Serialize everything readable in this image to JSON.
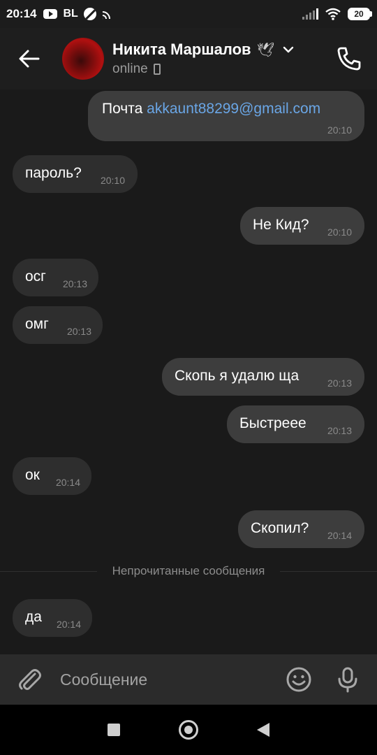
{
  "status_bar": {
    "time": "20:14",
    "carrier_badge": "BL",
    "battery": "20"
  },
  "header": {
    "contact_name": "Никита Маршалов",
    "status": "online",
    "name_emoji": "🕊"
  },
  "messages": [
    {
      "direction": "out",
      "text_prefix": "Почта ",
      "link": "akkaunt88299@gmail.com",
      "time": "20:10"
    },
    {
      "direction": "in",
      "text": "пароль?",
      "time": "20:10"
    },
    {
      "direction": "out",
      "text": "Не Кид?",
      "time": "20:10"
    },
    {
      "direction": "in",
      "text": "осг",
      "time": "20:13"
    },
    {
      "direction": "in",
      "text": "омг",
      "time": "20:13"
    },
    {
      "direction": "out",
      "text": "Скопь я удалю ща",
      "time": "20:13"
    },
    {
      "direction": "out",
      "text": "Быстреее",
      "time": "20:13"
    },
    {
      "direction": "in",
      "text": "ок",
      "time": "20:14"
    },
    {
      "direction": "out",
      "text": "Скопил?",
      "time": "20:14"
    },
    {
      "direction": "in",
      "text": "да",
      "time": "20:14"
    }
  ],
  "unread_divider": "Непрочитанные сообщения",
  "composer": {
    "placeholder": "Сообщение"
  },
  "colors": {
    "background": "#1a1a1a",
    "bubble_out": "#3d3d3d",
    "bubble_in": "#2e2e2e",
    "link": "#6aa6e6"
  }
}
